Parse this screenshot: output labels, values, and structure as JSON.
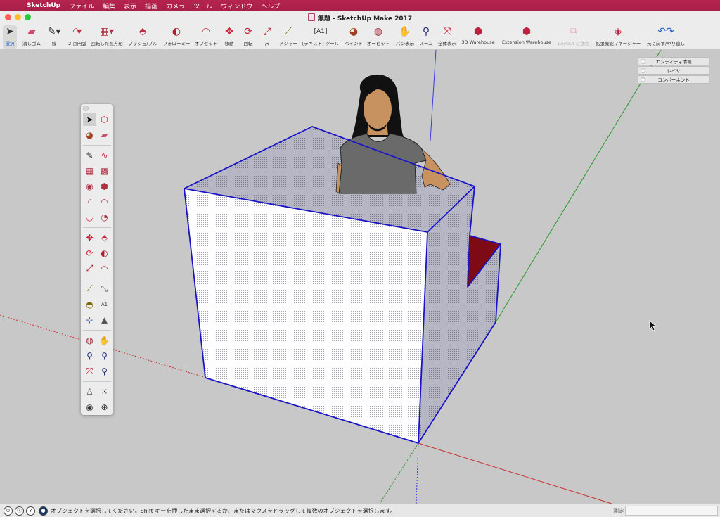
{
  "menubar": {
    "app": "SketchUp",
    "items": [
      "ファイル",
      "編集",
      "表示",
      "描画",
      "カメラ",
      "ツール",
      "ウィンドウ",
      "ヘルプ"
    ]
  },
  "window": {
    "title": "無題 - SketchUp Make 2017"
  },
  "toolbar": {
    "select": "選択",
    "eraser": "消しゴム",
    "line": "線",
    "arc": "2 点円弧",
    "rotated_rect": "回転した長方形",
    "pushpull": "プッシュ/プル",
    "followme": "フォローミー",
    "offset": "オフセット",
    "move": "移動",
    "rotate": "回転",
    "scale": "尺",
    "tape": "メジャー",
    "text": "[テキスト] ツール",
    "paint": "ペイント",
    "orbit": "オービット",
    "pan": "パン表示",
    "zoom": "ズーム",
    "zoom_extents": "全体表示",
    "warehouse": "3D Warehouse",
    "ext_warehouse": "Extension Warehouse",
    "layout": "LayOut に送信",
    "ext_manager": "拡張機能マネージャー",
    "undo_redo": "元に戻す/やり直し"
  },
  "trays": [
    "エンティティ情報",
    "レイヤ",
    "コンポーネント"
  ],
  "statusbar": {
    "message": "オブジェクトを選択してください。Shift キーを押したまま選択するか、またはマウスをドラッグして複数のオブジェクトを選択します。",
    "measure_label": "測定",
    "measure_value": ""
  },
  "colors": {
    "menubar": "#b5244e",
    "selection": "#1a14c8",
    "accent": "#2a62c9"
  }
}
